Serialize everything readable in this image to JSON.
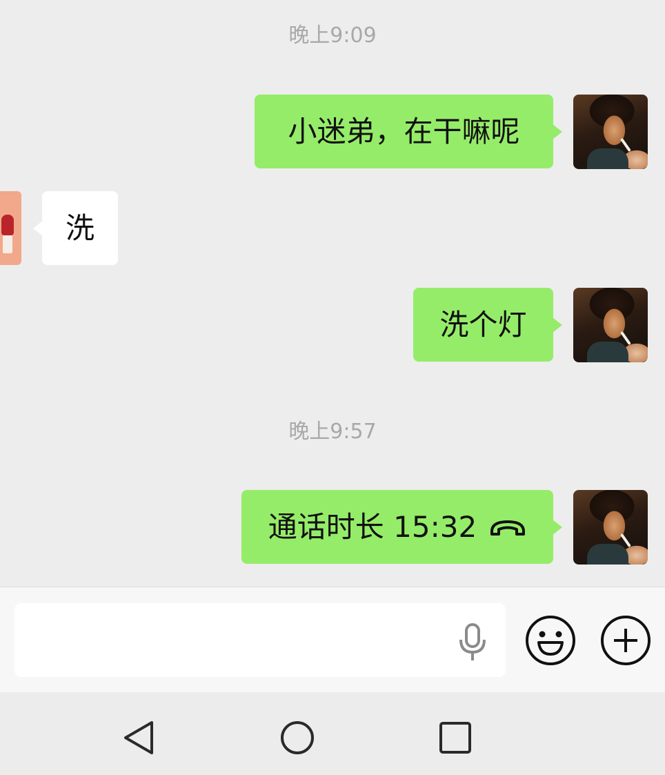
{
  "chat": {
    "timestamps": [
      "晚上9:09",
      "晚上9:57"
    ],
    "messages": [
      {
        "from": "me",
        "text": "小迷弟，在干嘛呢"
      },
      {
        "from": "other",
        "text": "洗"
      },
      {
        "from": "me",
        "text": "洗个灯"
      },
      {
        "from": "me",
        "text": "通话时长 15:32",
        "icon": "hang-up-phone-icon"
      }
    ]
  },
  "input_bar": {
    "value": "",
    "placeholder": "",
    "icons": [
      "microphone-icon",
      "emoji-icon",
      "plus-icon"
    ]
  },
  "nav_bar": {
    "icons": [
      "back-triangle-icon",
      "home-circle-icon",
      "recents-square-icon"
    ]
  },
  "colors": {
    "chat_background": "#ededed",
    "my_bubble": "#95ec69",
    "other_bubble": "#ffffff",
    "timestamp_text": "#a8a8a8"
  }
}
